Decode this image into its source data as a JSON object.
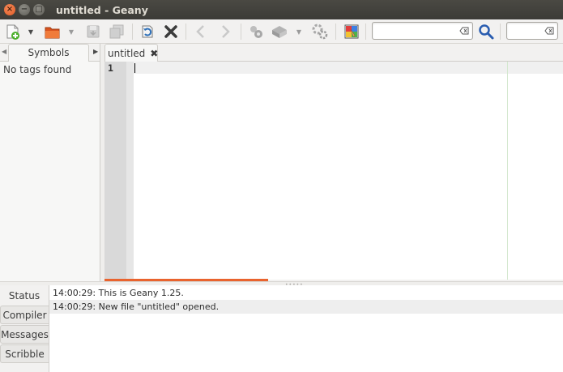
{
  "window": {
    "title": "untitled - Geany"
  },
  "toolbar": {
    "icons": [
      "new-file-icon",
      "open-file-icon",
      "save-icon",
      "save-all-icon",
      "reload-icon",
      "close-icon",
      "back-icon",
      "forward-icon",
      "compile-icon",
      "build-icon",
      "run-icon",
      "color-chooser-icon",
      "search-icon"
    ],
    "search_value": "",
    "goto_value": ""
  },
  "sidebar": {
    "tab_label": "Symbols",
    "empty_text": "No tags found"
  },
  "editor": {
    "tab_label": "untitled",
    "line_numbers": [
      "1"
    ]
  },
  "message_window": {
    "tabs": [
      {
        "label": "Status",
        "active": true
      },
      {
        "label": "Compiler",
        "active": false
      },
      {
        "label": "Messages",
        "active": false
      },
      {
        "label": "Scribble",
        "active": false
      }
    ],
    "messages": [
      "14:00:29: This is Geany 1.25.",
      "14:00:29: New file \"untitled\" opened."
    ]
  }
}
